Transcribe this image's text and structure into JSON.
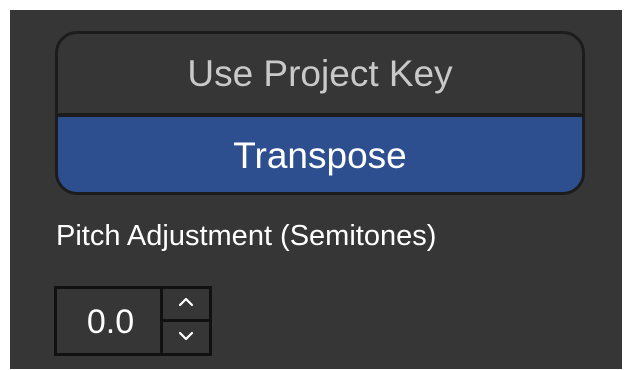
{
  "key_mode": {
    "options": [
      {
        "label": "Use Project Key",
        "selected": false
      },
      {
        "label": "Transpose",
        "selected": true
      }
    ],
    "selected_color": "#2e4f8f"
  },
  "pitch": {
    "label": "Pitch Adjustment (Semitones)",
    "value": "0.0",
    "up_icon": "chevron-up-icon",
    "down_icon": "chevron-down-icon"
  }
}
